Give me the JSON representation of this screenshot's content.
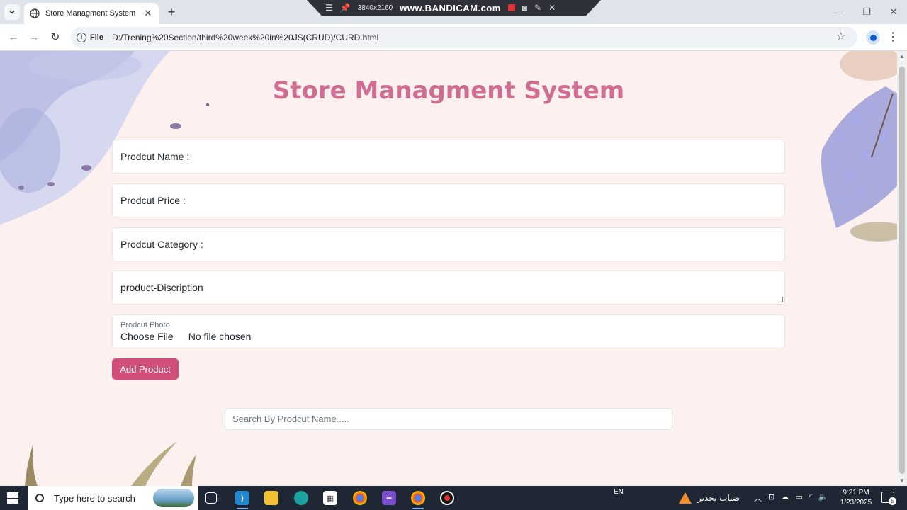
{
  "browser": {
    "tab_title": "Store Managment System",
    "new_tab": "+",
    "close_tab": "✕",
    "scheme_label": "File",
    "url": "D:/Trening%20Section/third%20week%20in%20JS(CRUD)/CURD.html",
    "window_min": "—",
    "window_restore": "❐",
    "window_close": "✕"
  },
  "recorder": {
    "resolution": "3840x2160",
    "brand": "www.BANDICAM.com"
  },
  "page": {
    "heading": "Store Managment System",
    "form": {
      "name_label": "Prodcut Name :",
      "price_label": "Prodcut Price :",
      "category_label": "Prodcut Category :",
      "description_label": "product-Discription",
      "photo_label": "Prodcut Photo",
      "choose_file": "Choose File",
      "no_file": "No file chosen",
      "add_button": "Add Product"
    },
    "search_placeholder": "Search By Prodcut Name....."
  },
  "taskbar": {
    "search_text": "Type here to search",
    "language": "EN",
    "weather_text": "ضباب تحذير",
    "time": "9:21 PM",
    "date": "1/23/2025",
    "notification_count": "5"
  },
  "colors": {
    "heading": "#cf6e92",
    "button": "#d14f7b",
    "page_bg": "#fdf1ef"
  }
}
